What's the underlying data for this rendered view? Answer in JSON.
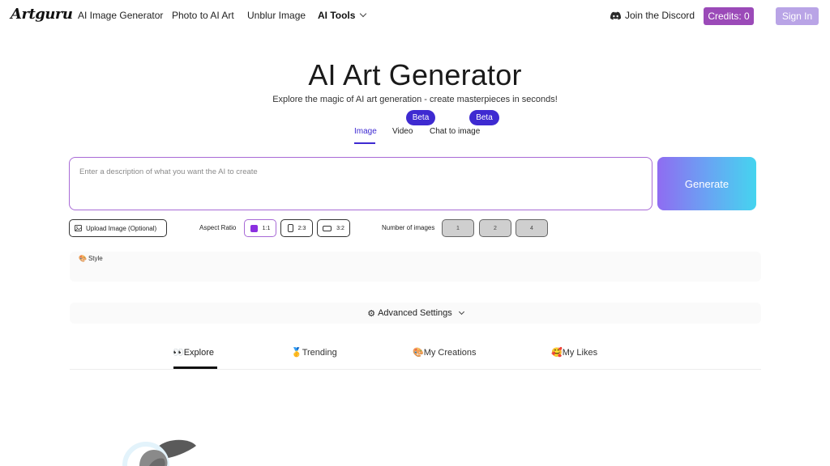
{
  "header": {
    "logo": "Artguru",
    "nav": [
      {
        "label": "AI Image Generator"
      },
      {
        "label": "Photo to AI Art"
      },
      {
        "label": "Unblur Image"
      },
      {
        "label": "AI Tools"
      }
    ],
    "discord_label": "Join the Discord",
    "credits_label": "Credits: 0",
    "signin_label": "Sign In"
  },
  "hero": {
    "title": "AI Art Generator",
    "subtitle": "Explore the magic of AI art generation - create masterpieces in seconds!"
  },
  "mode_tabs": [
    {
      "label": "Image",
      "badge": "",
      "active": true
    },
    {
      "label": "Video",
      "badge": "Beta",
      "active": false
    },
    {
      "label": "Chat to image",
      "badge": "Beta",
      "active": false
    }
  ],
  "prompt": {
    "placeholder": "Enter a description of what you want the AI to create",
    "value": ""
  },
  "generate_label": "Generate",
  "options": {
    "upload_label": "Upload Image (Optional)",
    "aspect_ratio_label": "Aspect Ratio",
    "aspect_ratios": [
      "1:1",
      "2:3",
      "3:2"
    ],
    "aspect_ratio_selected": "1:1",
    "num_images_label": "Number of images",
    "num_images": [
      "1",
      "2",
      "4"
    ]
  },
  "style": {
    "icon": "🎨",
    "label": "Style"
  },
  "advanced": {
    "icon": "⚙",
    "label": "Advanced Settings"
  },
  "gallery_tabs": [
    {
      "icon": "👀",
      "label": "Explore",
      "active": true
    },
    {
      "icon": "🥇",
      "label": "Trending",
      "active": false
    },
    {
      "icon": "🎨",
      "label": "My Creations",
      "active": false
    },
    {
      "icon": "🥰",
      "label": "My Likes",
      "active": false
    }
  ],
  "colors": {
    "accent": "#3e2ad1",
    "credits_bg": "#9b4ab8",
    "signin_bg": "#b9a4e6",
    "prompt_border": "#a86ad6",
    "generate_gradient_start": "#8f6cf2",
    "generate_gradient_end": "#45d4ef"
  }
}
